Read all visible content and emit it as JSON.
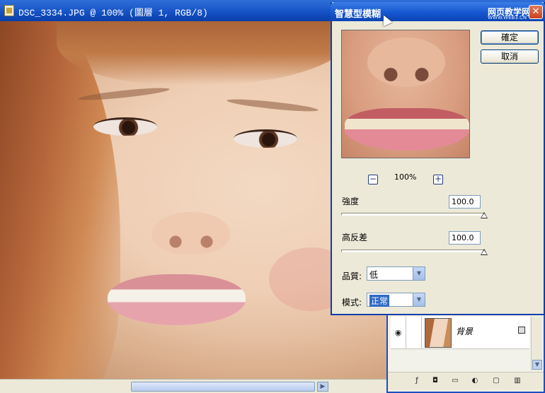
{
  "document": {
    "title": "DSC_3334.JPG @ 100% (圖層 1, RGB/8)"
  },
  "dialog": {
    "title": "智慧型模糊",
    "watermark_logo": "网页教学网",
    "watermark_url": "WWW.WEB3.CN",
    "ok_label": "確定",
    "cancel_label": "取消",
    "close_symbol": "✕",
    "zoom": {
      "minus": "−",
      "value": "100%",
      "plus": "+"
    },
    "radius": {
      "label": "強度",
      "value": "100.0",
      "slider_fraction": 1.0
    },
    "threshold": {
      "label": "高反差",
      "value": "100.0",
      "slider_fraction": 1.0
    },
    "quality": {
      "label": "品質:",
      "selected": "低"
    },
    "mode": {
      "label": "模式:",
      "selected": "正常"
    }
  },
  "layers": {
    "layer_name": "背景",
    "eye_symbol": "◉"
  },
  "icons": {
    "file": "file-icon",
    "cursor": "cursor-icon",
    "lock": "lock-icon",
    "dropdown": "chevron-down-icon"
  }
}
